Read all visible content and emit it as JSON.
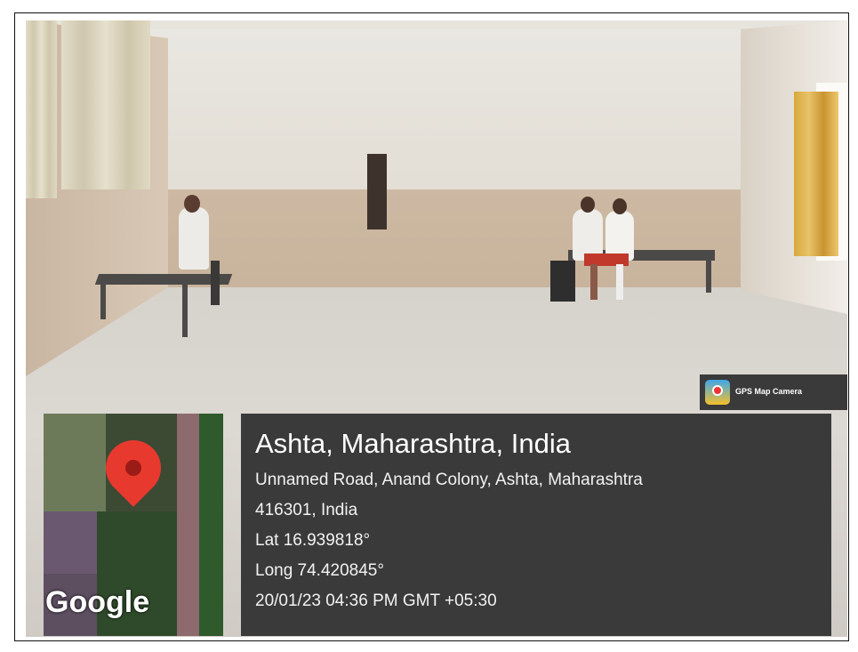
{
  "badge": {
    "label": "GPS Map Camera",
    "icon": "gps-map-camera-app-icon"
  },
  "map": {
    "provider_label": "Google",
    "pin_icon": "location-pin-icon"
  },
  "location": {
    "title": "Ashta, Maharashtra, India",
    "address_line1": "Unnamed Road, Anand Colony, Ashta, Maharashtra",
    "address_line2": "416301, India",
    "latitude": "Lat 16.939818°",
    "longitude": "Long 74.420845°",
    "timestamp": "20/01/23 04:36 PM GMT +05:30"
  },
  "colors": {
    "overlay_bg": "#3a3a3a",
    "pin": "#e8392f",
    "text": "#ffffff"
  }
}
